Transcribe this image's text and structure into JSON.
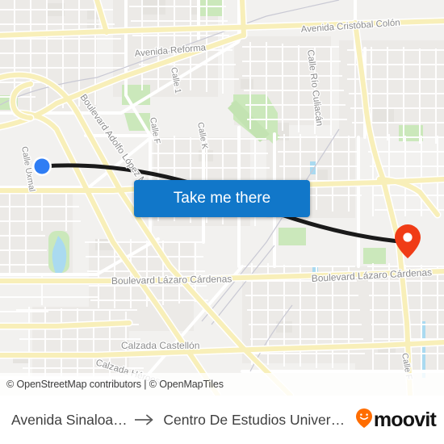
{
  "map": {
    "attribution": "© OpenStreetMap contributors | © OpenMapTiles",
    "origin_marker_name": "Avenida Sinaloa",
    "destination_marker_name": "Centro De Estudios Universitarios",
    "colors": {
      "route_line": "#1a1a1a",
      "origin_dot": "#2f7df4",
      "destination_pin": "#f03c16",
      "major_road": "#f8efb9",
      "minor_road": "#ffffff",
      "land": "#f2f1ef",
      "park": "#cbe8bb",
      "water": "#aadaf0",
      "building": "#e9e8e5"
    },
    "labels": [
      "Avenida Cristóbal Colón",
      "Avenida Reforma",
      "Calle 1",
      "Calle Río Culiacán",
      "Boulevard Adolfo López M",
      "Calle F",
      "Calle K",
      "Calle Uxmal",
      "Boulevard Lázaro Cárdenas",
      "Calzada Castellón",
      "Calzada Héroes",
      "Calle F"
    ]
  },
  "cta": {
    "label": "Take me there"
  },
  "bottom_bar": {
    "origin": "Avenida Sinaloa / ...",
    "arrow": "→",
    "destination": "Centro De Estudios Universita...",
    "brand": "moovit",
    "brand_color": "#ff6d00"
  }
}
